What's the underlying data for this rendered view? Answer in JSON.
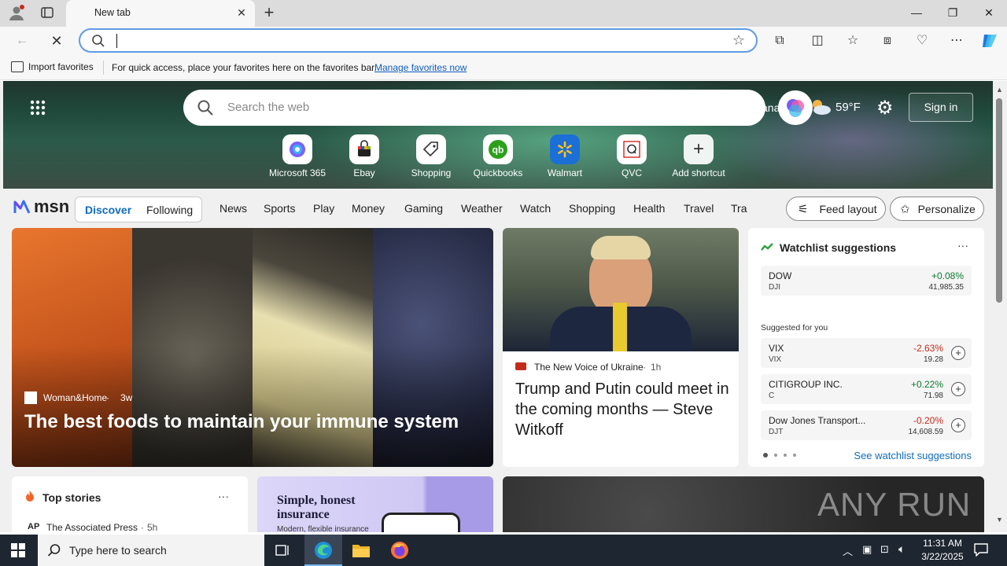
{
  "browser": {
    "tab_title": "New tab",
    "new_tab_symbol": "+",
    "address_value": "",
    "favbar": {
      "import_label": "Import favorites",
      "message": "For quick access, place your favorites here on the favorites bar.",
      "manage_link": "Manage favorites now"
    }
  },
  "hero": {
    "search_placeholder": "Search the web",
    "location_fragment": "anarfuft",
    "temperature": "59°F",
    "sign_in": "Sign in",
    "shortcuts": [
      {
        "label": "Microsoft 365",
        "icon": "m365-icon"
      },
      {
        "label": "Ebay",
        "icon": "ebay-icon"
      },
      {
        "label": "Shopping",
        "icon": "shopping-tag-icon"
      },
      {
        "label": "Quickbooks",
        "icon": "quickbooks-icon"
      },
      {
        "label": "Walmart",
        "icon": "walmart-icon"
      },
      {
        "label": "QVC",
        "icon": "qvc-icon"
      },
      {
        "label": "Add shortcut",
        "icon": "plus-icon"
      }
    ]
  },
  "nav": {
    "logo": "msn",
    "discover": "Discover",
    "following": "Following",
    "items": [
      "News",
      "Sports",
      "Play",
      "Money",
      "Gaming",
      "Weather",
      "Watch",
      "Shopping",
      "Health",
      "Travel",
      "Tra"
    ],
    "feed_layout": "Feed layout",
    "personalize": "Personalize"
  },
  "cards": {
    "main": {
      "source": "Woman&Home",
      "age": "3w",
      "title": "The best foods to maintain your immune system"
    },
    "news": {
      "source": "The New Voice of Ukraine",
      "age": "1h",
      "title": "Trump and Putin could meet in the coming months — Steve Witkoff"
    },
    "watchlist": {
      "title": "Watchlist suggestions",
      "more": "···",
      "primary": {
        "name": "DOW",
        "symbol": "DJI",
        "change": "+0.08%",
        "price": "41,985.35"
      },
      "suggested_label": "Suggested for you",
      "items": [
        {
          "name": "VIX",
          "symbol": "VIX",
          "change": "-2.63%",
          "price": "19.28"
        },
        {
          "name": "CITIGROUP INC.",
          "symbol": "C",
          "change": "+0.22%",
          "price": "71.98"
        },
        {
          "name": "Dow Jones Transport...",
          "symbol": "DJT",
          "change": "-0.20%",
          "price": "14,608.59"
        }
      ],
      "see_more": "See watchlist suggestions"
    },
    "top_stories": {
      "title": "Top stories",
      "more": "···",
      "source_logo": "AP",
      "source": "The Associated Press",
      "age": "5h"
    },
    "ad": {
      "headline": "Simple, honest insurance",
      "sub": "Modern, flexible insurance"
    },
    "watermark": "ANY RUN"
  },
  "taskbar": {
    "search_placeholder": "Type here to search",
    "time": "11:31 AM",
    "date": "3/22/2025"
  },
  "colors": {
    "accent": "#0f6cbd",
    "positive": "#0a7a2f",
    "negative": "#c42b1c",
    "taskbar": "#1e2631"
  }
}
